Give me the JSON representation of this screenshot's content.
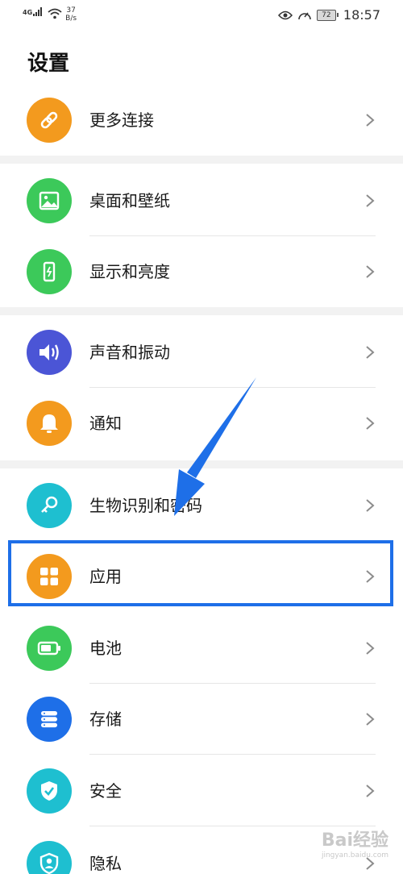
{
  "status_bar": {
    "network": "4G",
    "speed_value": "37",
    "speed_unit": "B/s",
    "battery": "72",
    "time": "18:57"
  },
  "page": {
    "title": "设置"
  },
  "rows": [
    {
      "label": "更多连接",
      "icon": "link-icon",
      "color": "#F39A1E"
    },
    {
      "label": "桌面和壁纸",
      "icon": "image-icon",
      "color": "#3CC95A"
    },
    {
      "label": "显示和亮度",
      "icon": "phone-brightness-icon",
      "color": "#3CC95A"
    },
    {
      "label": "声音和振动",
      "icon": "speaker-icon",
      "color": "#4B55D6"
    },
    {
      "label": "通知",
      "icon": "bell-icon",
      "color": "#F39A1E"
    },
    {
      "label": "生物识别和密码",
      "icon": "key-icon",
      "color": "#1EBFD0"
    },
    {
      "label": "应用",
      "icon": "apps-grid-icon",
      "color": "#F39A1E"
    },
    {
      "label": "电池",
      "icon": "battery-icon",
      "color": "#3CC95A"
    },
    {
      "label": "存储",
      "icon": "storage-icon",
      "color": "#1E6FE8"
    },
    {
      "label": "安全",
      "icon": "shield-check-icon",
      "color": "#1EBFD0"
    },
    {
      "label": "隐私",
      "icon": "privacy-user-shield-icon",
      "color": "#1EBFD0"
    }
  ],
  "annotation": {
    "highlight_color": "#1E6FE8",
    "arrow_color": "#1E6FE8"
  },
  "watermark": {
    "main": "Bai经验",
    "sub": "jingyan.baidu.com"
  }
}
